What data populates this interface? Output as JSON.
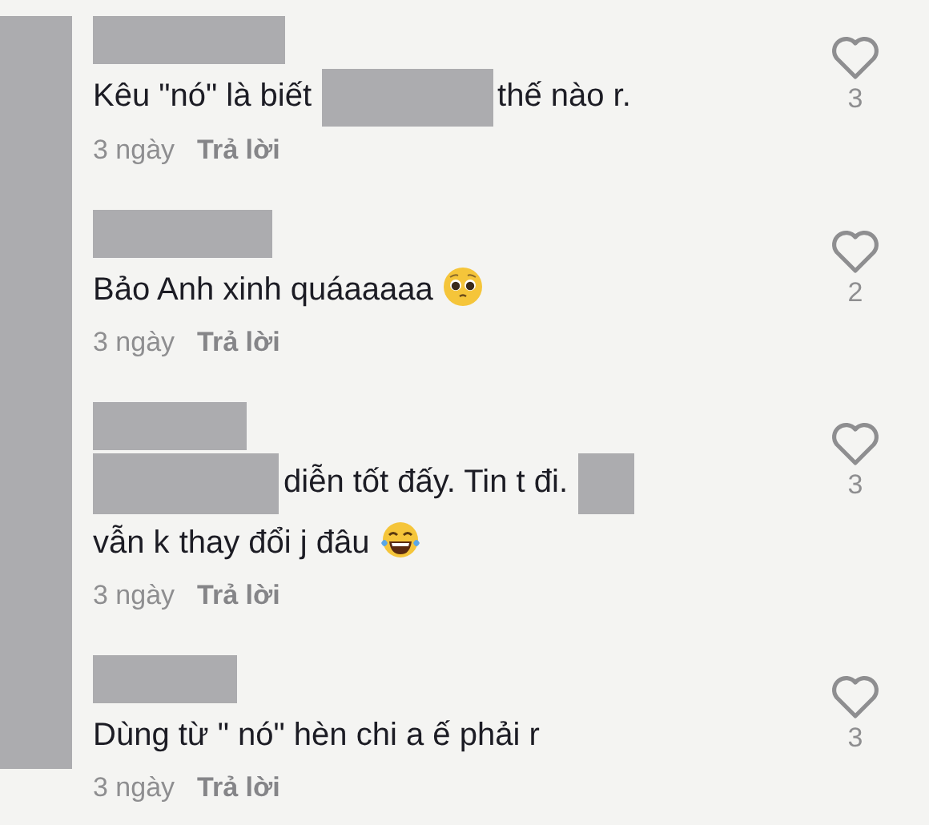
{
  "comments": [
    {
      "username_hidden": true,
      "text": [
        {
          "kind": "text",
          "text": "Kêu \"nó\" là biết"
        },
        {
          "kind": "redacted"
        },
        {
          "kind": "text",
          "text": "thế nào r."
        }
      ],
      "age": "3 ngày",
      "reply": "Trả lời",
      "likes": "3"
    },
    {
      "username_hidden": true,
      "text": [
        {
          "kind": "text",
          "text": "Bảo Anh xinh quáaaaaa"
        },
        {
          "kind": "pleading_emoji"
        }
      ],
      "age": "3 ngày",
      "reply": "Trả lời",
      "likes": "2"
    },
    {
      "username_hidden": true,
      "text": [
        {
          "kind": "redacted"
        },
        {
          "kind": "text",
          "text": "diễn tốt đấy. Tin t đi."
        },
        {
          "kind": "redacted"
        },
        {
          "kind": "text",
          "text": "vẫn k"
        },
        {
          "kind": "text",
          "text": "thay đổi j đâu"
        },
        {
          "kind": "laughing_emoji"
        }
      ],
      "age": "3 ngày",
      "reply": "Trả lời",
      "likes": "3"
    },
    {
      "username_hidden": true,
      "text": [
        {
          "kind": "text",
          "text": "Dùng từ \" nó\" hèn chi a ế phải r"
        }
      ],
      "age": "3 ngày",
      "reply": "Trả lời",
      "likes": "3"
    }
  ]
}
